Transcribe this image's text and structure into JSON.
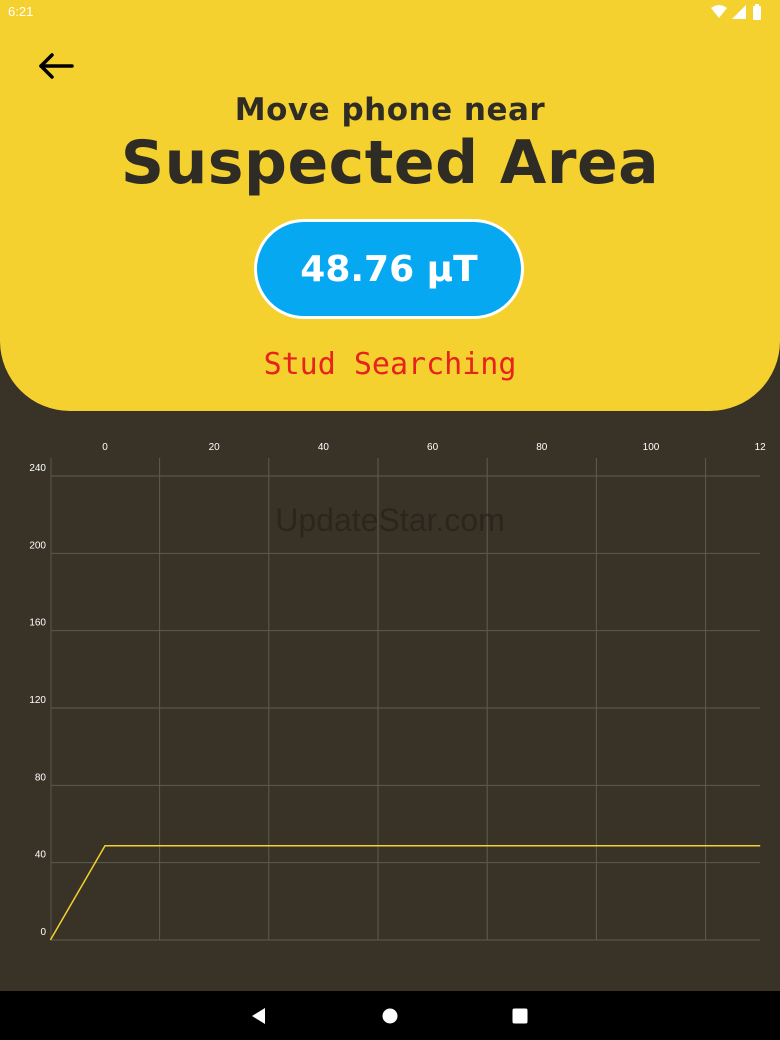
{
  "status_bar": {
    "time": "6:21",
    "icons": [
      "wifi-icon",
      "cellular-signal-icon",
      "battery-icon"
    ]
  },
  "header": {
    "back_icon": "arrow-left-icon",
    "subtitle": "Move phone near",
    "title": "Suspected Area",
    "reading": "48.76 µT",
    "mode": "Stud Searching",
    "colors": {
      "background": "#f5d12f",
      "pill": "#06a8f2",
      "mode_text": "#e6231c"
    }
  },
  "watermark": "UpdateStar.com",
  "chart_data": {
    "type": "line",
    "x_ticks": [
      "0",
      "20",
      "40",
      "60",
      "80",
      "100",
      "12"
    ],
    "y_ticks": [
      "240",
      "200",
      "160",
      "120",
      "80",
      "40",
      "0"
    ],
    "xlim": [
      -10,
      120
    ],
    "ylim": [
      0,
      240
    ],
    "grid": true,
    "x_axis_position": "top",
    "series": [
      {
        "color": "#f5d12f",
        "points": [
          [
            -10,
            0
          ],
          [
            0,
            48.76
          ],
          [
            120,
            48.76
          ]
        ]
      }
    ]
  },
  "nav_bar": {
    "buttons": [
      "back-triangle-icon",
      "home-circle-icon",
      "recents-square-icon"
    ]
  }
}
